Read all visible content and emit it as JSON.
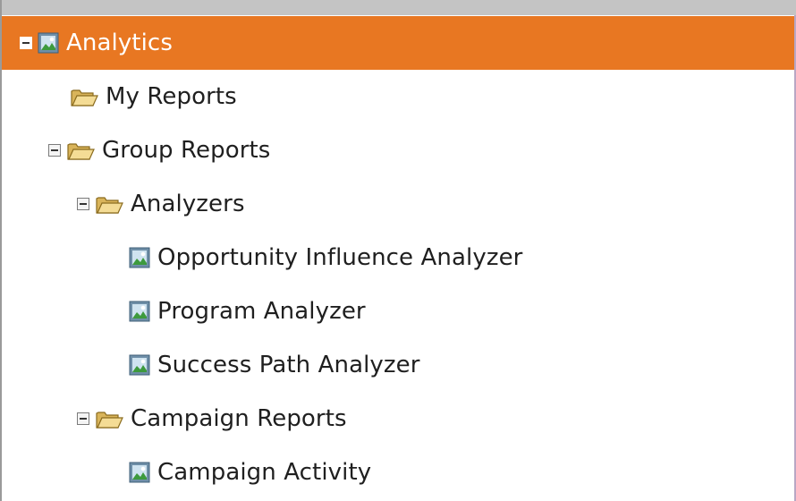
{
  "tree": {
    "root": {
      "label": "Analytics",
      "icon": "report-icon",
      "expanded": true,
      "selected": true
    },
    "my_reports": {
      "label": "My Reports",
      "icon": "folder-icon"
    },
    "group_reports": {
      "label": "Group Reports",
      "icon": "folder-icon",
      "expanded": true
    },
    "analyzers": {
      "label": "Analyzers",
      "icon": "folder-icon",
      "expanded": true
    },
    "opportunity_influence_analyzer": {
      "label": "Opportunity Influence Analyzer",
      "icon": "report-icon"
    },
    "program_analyzer": {
      "label": "Program Analyzer",
      "icon": "report-icon"
    },
    "success_path_analyzer": {
      "label": "Success Path Analyzer",
      "icon": "report-icon"
    },
    "campaign_reports": {
      "label": "Campaign Reports",
      "icon": "folder-icon",
      "expanded": true
    },
    "campaign_activity": {
      "label": "Campaign Activity",
      "icon": "report-icon"
    }
  },
  "colors": {
    "selected_background": "#e87722",
    "top_bar": "#c4c4c4",
    "text": "#1f1f1f"
  }
}
